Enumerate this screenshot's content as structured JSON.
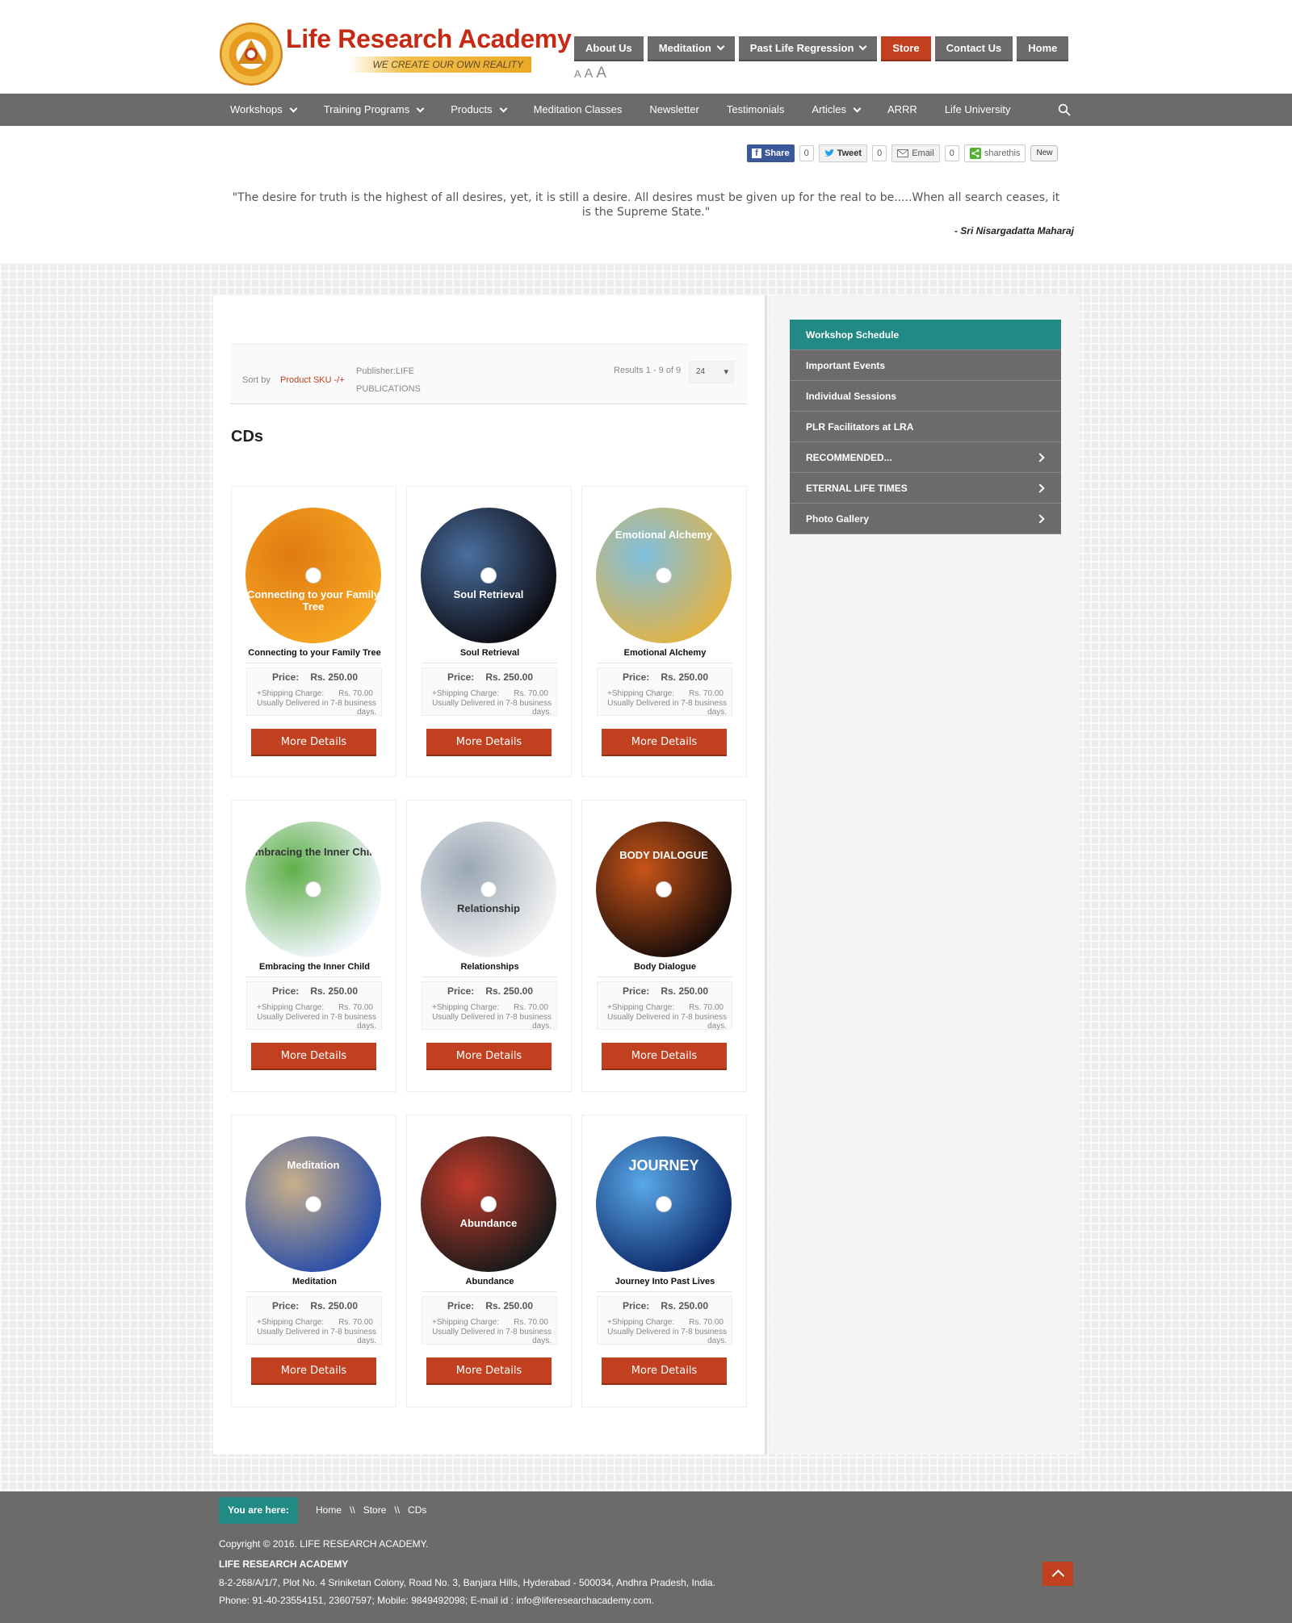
{
  "header": {
    "logo_name": "Life Research Academy",
    "logo_tagline": "WE CREATE OUR OWN REALITY",
    "logo_seal_text": "LIFE RESEARCH ACADEMY",
    "top_nav": [
      {
        "label": "About Us",
        "dropdown": false,
        "active": false
      },
      {
        "label": "Meditation",
        "dropdown": true,
        "active": false
      },
      {
        "label": "Past Life Regression",
        "dropdown": true,
        "active": false
      },
      {
        "label": "Store",
        "dropdown": false,
        "active": true
      },
      {
        "label": "Contact Us",
        "dropdown": false,
        "active": false
      },
      {
        "label": "Home",
        "dropdown": false,
        "active": false
      }
    ],
    "font_size_controls": [
      "A",
      "A",
      "A"
    ]
  },
  "main_nav": [
    {
      "label": "Workshops",
      "dropdown": true
    },
    {
      "label": "Training Programs",
      "dropdown": true
    },
    {
      "label": "Products",
      "dropdown": true
    },
    {
      "label": "Meditation Classes",
      "dropdown": false
    },
    {
      "label": "Newsletter",
      "dropdown": false
    },
    {
      "label": "Testimonials",
      "dropdown": false
    },
    {
      "label": "Articles",
      "dropdown": true
    },
    {
      "label": "ARRR",
      "dropdown": false
    },
    {
      "label": "Life University",
      "dropdown": false
    }
  ],
  "share": {
    "facebook": {
      "label": "Share",
      "count": "0"
    },
    "twitter": {
      "label": "Tweet",
      "count": "0"
    },
    "email": {
      "label": "Email",
      "count": "0"
    },
    "sharethis": {
      "label": "sharethis",
      "badge": "New"
    }
  },
  "quote": {
    "text": "\"The desire for truth is the highest of all desires, yet, it is still a desire. All desires must be given up for the real to be.....When all search ceases, it is the Supreme State.\"",
    "author": "- Sri Nisargadatta Maharaj"
  },
  "catalog": {
    "sort_label": "Sort by",
    "sort_value": "Product SKU -/+",
    "publisher": "Publisher:LIFE PUBLICATIONS",
    "results": "Results 1 - 9 of 9",
    "per_page": "24",
    "category_title": "CDs"
  },
  "products": [
    {
      "name": "Connecting to your Family Tree",
      "disc_text": "Connecting to your Family Tree",
      "price_label": "Price:",
      "price": "Rs. 250.00",
      "ship_label": "+Shipping Charge:",
      "ship_value": "Rs. 70.00",
      "delivery": "Usually Delivered in 7-8 business days.",
      "button": "More Details",
      "colors": [
        "#f6a623",
        "#e07a10"
      ]
    },
    {
      "name": "Soul Retrieval",
      "disc_text": "Soul Retrieval",
      "price_label": "Price:",
      "price": "Rs. 250.00",
      "ship_label": "+Shipping Charge:",
      "ship_value": "Rs. 70.00",
      "delivery": "Usually Delivered in 7-8 business days.",
      "button": "More Details",
      "colors": [
        "#0d0d14",
        "#4a6fa0"
      ]
    },
    {
      "name": "Emotional Alchemy",
      "disc_text": "Emotional Alchemy",
      "price_label": "Price:",
      "price": "Rs. 250.00",
      "ship_label": "+Shipping Charge:",
      "ship_value": "Rs. 70.00",
      "delivery": "Usually Delivered in 7-8 business days.",
      "button": "More Details",
      "colors": [
        "#e0b347",
        "#7fbfe0"
      ]
    },
    {
      "name": "Embracing the Inner Child",
      "disc_text": "Embracing the Inner Child",
      "price_label": "Price:",
      "price": "Rs. 250.00",
      "ship_label": "+Shipping Charge:",
      "ship_value": "Rs. 70.00",
      "delivery": "Usually Delivered in 7-8 business days.",
      "button": "More Details",
      "colors": [
        "#f3f7ff",
        "#5fb04a"
      ]
    },
    {
      "name": "Relationships",
      "disc_text": "Relationship",
      "price_label": "Price:",
      "price": "Rs. 250.00",
      "ship_label": "+Shipping Charge:",
      "ship_value": "Rs. 70.00",
      "delivery": "Usually Delivered in 7-8 business days.",
      "button": "More Details",
      "colors": [
        "#f2f2f2",
        "#9aa7b5"
      ]
    },
    {
      "name": "Body Dialogue",
      "disc_text": "BODY DIALOGUE",
      "price_label": "Price:",
      "price": "Rs. 250.00",
      "ship_label": "+Shipping Charge:",
      "ship_value": "Rs. 70.00",
      "delivery": "Usually Delivered in 7-8 business days.",
      "button": "More Details",
      "colors": [
        "#1b0e0a",
        "#c85418"
      ]
    },
    {
      "name": "Meditation",
      "disc_text": "Meditation",
      "price_label": "Price:",
      "price": "Rs. 250.00",
      "ship_label": "+Shipping Charge:",
      "ship_value": "Rs. 70.00",
      "delivery": "Usually Delivered in 7-8 business days.",
      "button": "More Details",
      "colors": [
        "#2c4fa8",
        "#c9b08a"
      ]
    },
    {
      "name": "Abundance",
      "disc_text": "Abundance",
      "price_label": "Price:",
      "price": "Rs. 250.00",
      "ship_label": "+Shipping Charge:",
      "ship_value": "Rs. 70.00",
      "delivery": "Usually Delivered in 7-8 business days.",
      "button": "More Details",
      "colors": [
        "#1a1a1a",
        "#c23b2b"
      ]
    },
    {
      "name": "Journey Into Past Lives",
      "disc_text": "JOURNEY",
      "price_label": "Price:",
      "price": "Rs. 250.00",
      "ship_label": "+Shipping Charge:",
      "ship_value": "Rs. 70.00",
      "delivery": "Usually Delivered in 7-8 business days.",
      "button": "More Details",
      "colors": [
        "#0d2a6b",
        "#5aa9e8"
      ]
    }
  ],
  "sidebar": [
    {
      "label": "Workshop Schedule",
      "active": true,
      "submenu": false
    },
    {
      "label": "Important Events",
      "active": false,
      "submenu": false
    },
    {
      "label": "Individual Sessions",
      "active": false,
      "submenu": false
    },
    {
      "label": "PLR Facilitators at LRA",
      "active": false,
      "submenu": false
    },
    {
      "label": "RECOMMENDED...",
      "active": false,
      "submenu": true
    },
    {
      "label": "ETERNAL LIFE TIMES",
      "active": false,
      "submenu": true
    },
    {
      "label": "Photo Gallery",
      "active": false,
      "submenu": true
    }
  ],
  "footer": {
    "you_are_here": "You are here:",
    "breadcrumb": [
      "Home",
      "\\\\",
      "Store",
      "\\\\",
      "CDs"
    ],
    "copyright": "Copyright © 2016. LIFE RESEARCH ACADEMY.",
    "org": "LIFE RESEARCH ACADEMY",
    "address": "8-2-268/A/1/7, Plot No. 4 Sriniketan Colony, Road No. 3, Banjara Hills, Hyderabad - 500034, Andhra Pradesh, India.",
    "phone": "Phone: 91-40-23554151, 23607597; Mobile: 9849492098; E-mail id : info@liferesearchacademy.com."
  },
  "colors": {
    "accent": "#c0401f",
    "nav_gray": "#6b6b6b",
    "teal": "#218a85"
  }
}
